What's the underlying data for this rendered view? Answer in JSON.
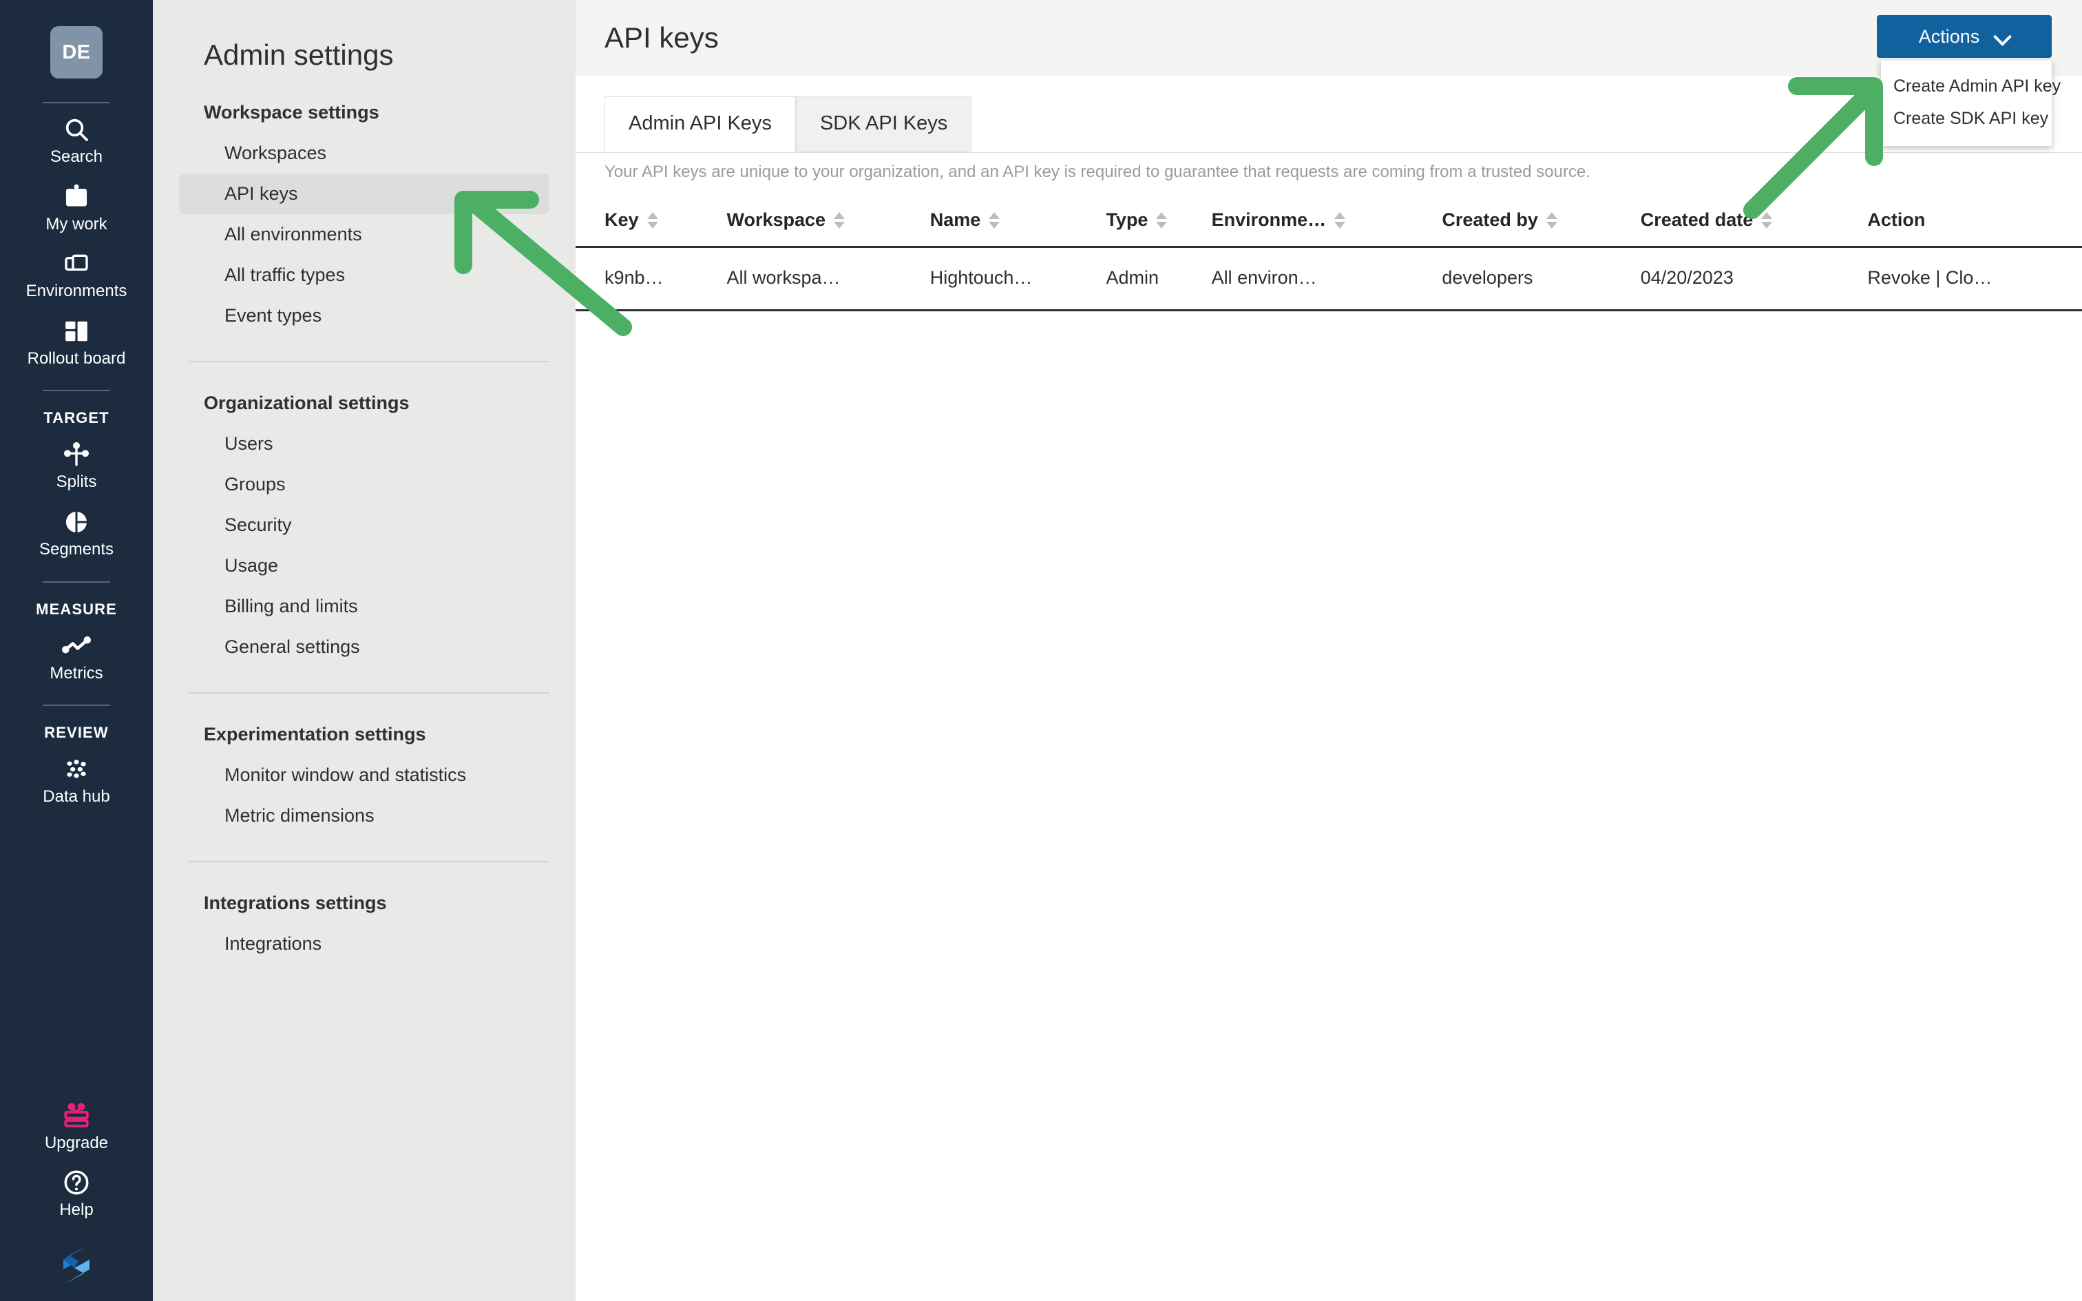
{
  "nav_rail": {
    "avatar_initials": "DE",
    "items": [
      {
        "label": "Search",
        "icon": "search-icon"
      },
      {
        "label": "My work",
        "icon": "my-work-icon"
      },
      {
        "label": "Environments",
        "icon": "environments-icon"
      },
      {
        "label": "Rollout board",
        "icon": "rollout-board-icon"
      }
    ],
    "sections": [
      {
        "title": "TARGET",
        "items": [
          {
            "label": "Splits",
            "icon": "splits-icon"
          },
          {
            "label": "Segments",
            "icon": "segments-icon"
          }
        ]
      },
      {
        "title": "MEASURE",
        "items": [
          {
            "label": "Metrics",
            "icon": "metrics-icon"
          }
        ]
      },
      {
        "title": "REVIEW",
        "items": [
          {
            "label": "Data hub",
            "icon": "data-hub-icon"
          }
        ]
      }
    ],
    "bottom_items": [
      {
        "label": "Upgrade",
        "icon": "gift-icon",
        "color": "#ec1e79"
      },
      {
        "label": "Help",
        "icon": "help-circle-icon",
        "color": "#ffffff"
      }
    ],
    "logo": "split-logo"
  },
  "settings_panel": {
    "title": "Admin settings",
    "groups": [
      {
        "title": "Workspace settings",
        "items": [
          {
            "label": "Workspaces",
            "active": false
          },
          {
            "label": "API keys",
            "active": true
          },
          {
            "label": "All environments",
            "active": false
          },
          {
            "label": "All traffic types",
            "active": false
          },
          {
            "label": "Event types",
            "active": false
          }
        ]
      },
      {
        "title": "Organizational settings",
        "items": [
          {
            "label": "Users",
            "active": false
          },
          {
            "label": "Groups",
            "active": false
          },
          {
            "label": "Security",
            "active": false
          },
          {
            "label": "Usage",
            "active": false
          },
          {
            "label": "Billing and limits",
            "active": false
          },
          {
            "label": "General settings",
            "active": false
          }
        ]
      },
      {
        "title": "Experimentation settings",
        "items": [
          {
            "label": "Monitor window and statistics",
            "active": false
          },
          {
            "label": "Metric dimensions",
            "active": false
          }
        ]
      },
      {
        "title": "Integrations settings",
        "items": [
          {
            "label": "Integrations",
            "active": false
          }
        ]
      }
    ]
  },
  "main": {
    "page_title": "API keys",
    "actions_button": {
      "label": "Actions",
      "icon": "chevron-down-icon"
    },
    "actions_menu": {
      "items": [
        {
          "label": "Create Admin API key"
        },
        {
          "label": "Create SDK API key"
        }
      ]
    },
    "tabs": [
      {
        "label": "Admin API Keys",
        "active": true
      },
      {
        "label": "SDK API Keys",
        "active": false
      }
    ],
    "description": "Your API keys are unique to your organization, and an API key is required to guarantee that requests are coming from a trusted source.",
    "table": {
      "columns": [
        {
          "label": "Key",
          "sortable": true
        },
        {
          "label": "Workspace",
          "sortable": true
        },
        {
          "label": "Name",
          "sortable": true
        },
        {
          "label": "Type",
          "sortable": true
        },
        {
          "label": "Environme…",
          "sortable": true
        },
        {
          "label": "Created by",
          "sortable": true
        },
        {
          "label": "Created date",
          "sortable": true
        },
        {
          "label": "Action",
          "sortable": false
        }
      ],
      "rows": [
        {
          "key": "k9nb…",
          "workspace": "All workspa…",
          "name": "Hightouch…",
          "type": "Admin",
          "environment": "All environ…",
          "created_by": "developers",
          "created_date": "04/20/2023",
          "action": "Revoke | Clo…"
        }
      ]
    }
  },
  "annotations": {
    "arrow_color": "#4caf63",
    "arrows": [
      {
        "name": "arrow-to-api-keys"
      },
      {
        "name": "arrow-to-actions-menu"
      }
    ]
  },
  "colors": {
    "nav_background": "#1c2b3e",
    "panel_background": "#e9e9e7",
    "accent_button": "#11619f",
    "upgrade_pink": "#ec1e79",
    "arrow_green": "#4caf63"
  }
}
